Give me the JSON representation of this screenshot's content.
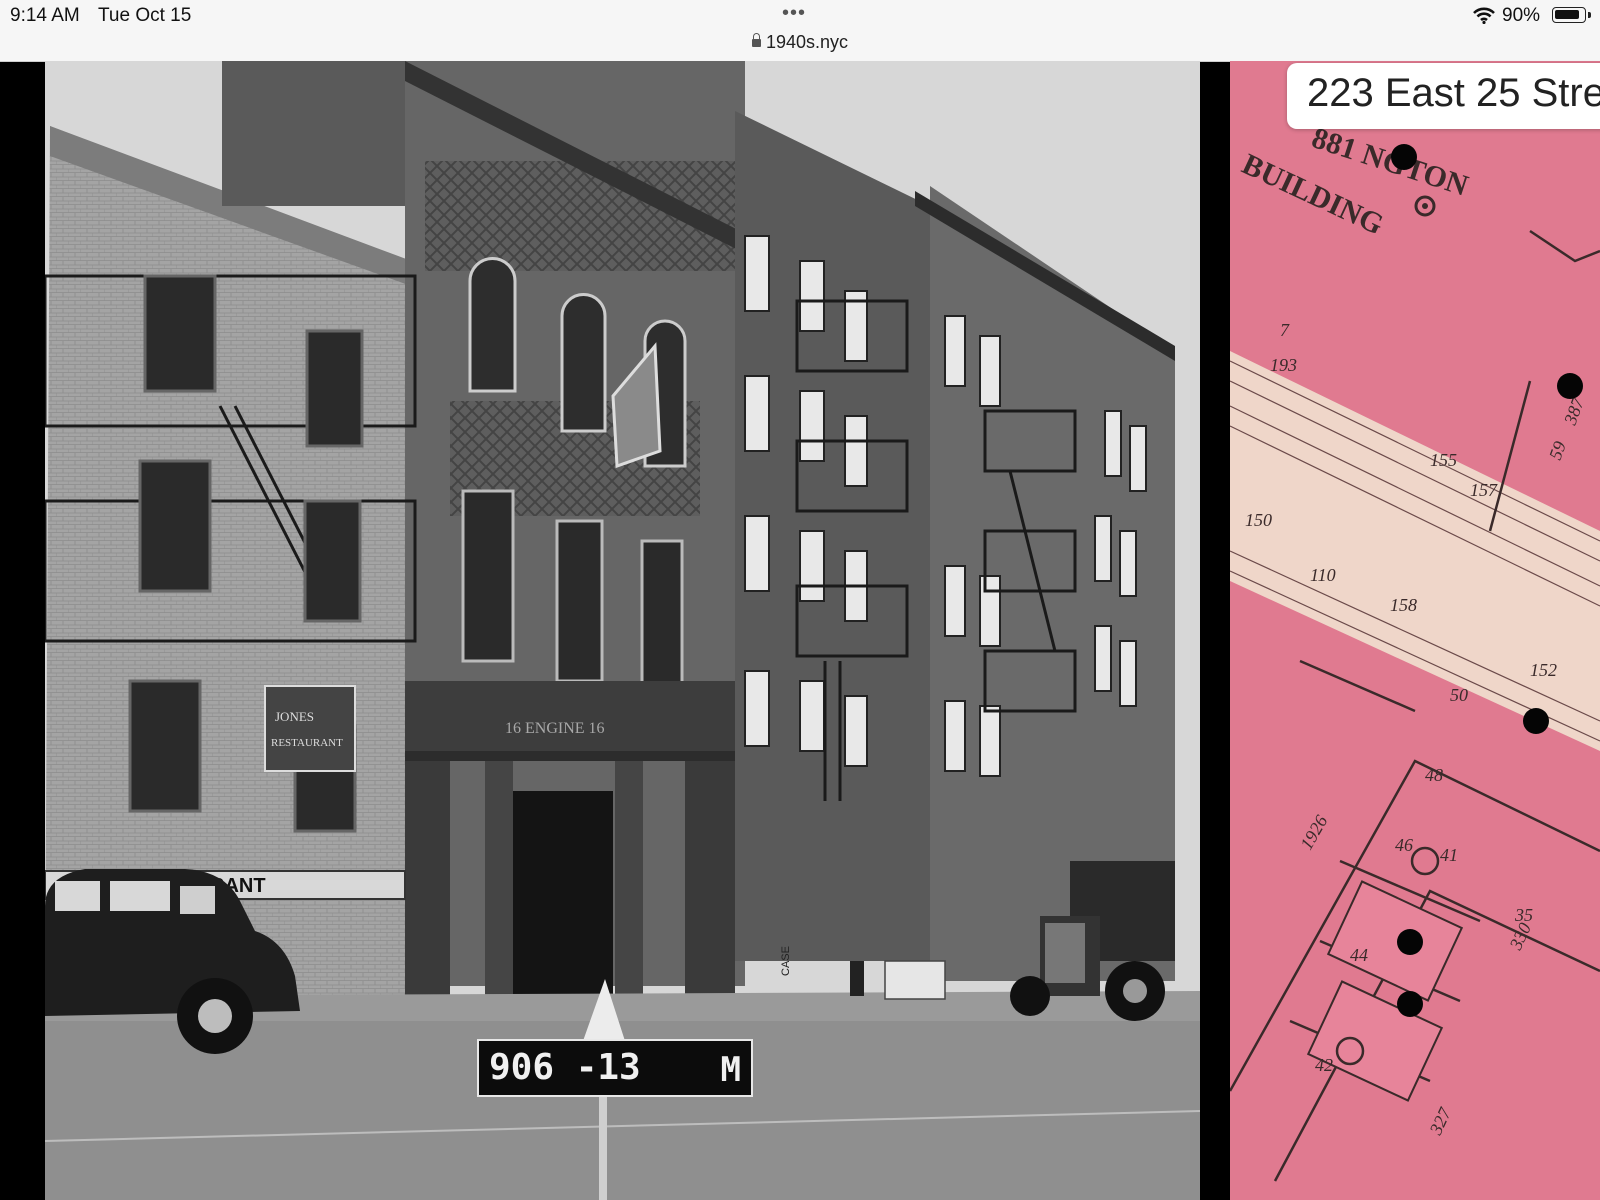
{
  "status_bar": {
    "time": "9:14 AM",
    "date": "Tue Oct 15",
    "menu_dots": "•••",
    "url": "1940s.nyc",
    "battery_percent": "90%",
    "battery_level": 0.9
  },
  "photo": {
    "tax_tag": {
      "number": "906 -13",
      "letter": "M"
    },
    "engine_sign": "16   ENGINE   16",
    "restaurant_sign_line1": "JONES",
    "restaurant_sign_line2": "RESTAURANT",
    "awning_text": "RANT",
    "side_label": "CASE"
  },
  "map": {
    "address": "223 East 25 Stre",
    "building_label_line1": "881   NGTON",
    "building_label_line2": "BUILDING",
    "lot_numbers": [
      "7",
      "193",
      "155",
      "157",
      "150",
      "110",
      "158",
      "152",
      "50",
      "48",
      "46",
      "44",
      "42",
      "41",
      "1926",
      "35",
      "330",
      "327",
      "59",
      "387"
    ]
  },
  "colors": {
    "map_pink": "#e07a90",
    "map_light": "#efd6c9",
    "pin": "#050505"
  }
}
